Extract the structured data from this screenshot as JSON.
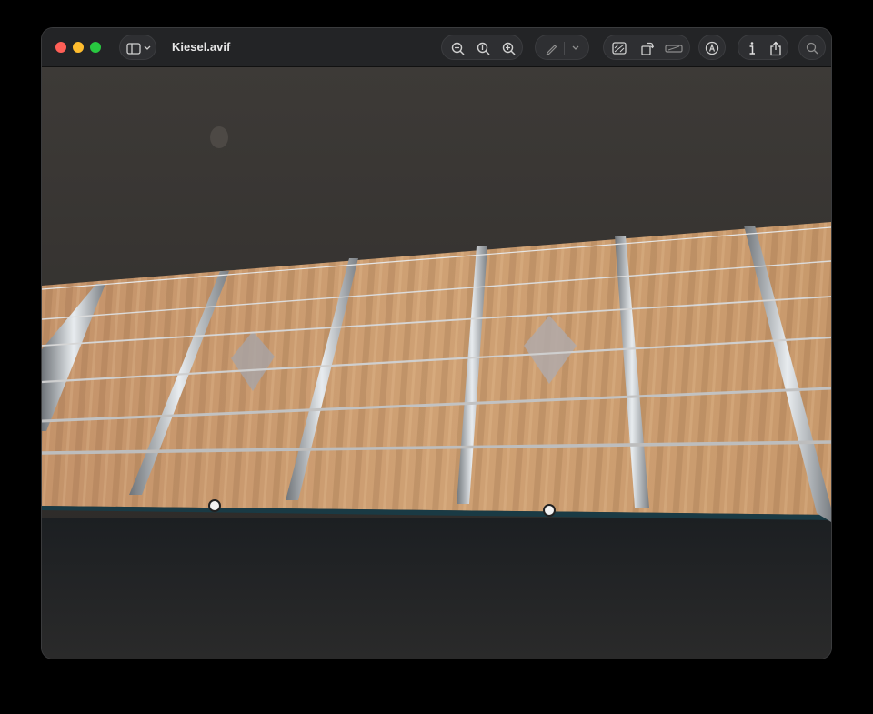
{
  "window": {
    "title": "Kiesel.avif"
  },
  "toolbar": {
    "icons": [
      "sidebar-toggle-icon",
      "chevron-down-icon",
      "zoom-out-icon",
      "actual-size-icon",
      "zoom-in-icon",
      "markup-pen-icon",
      "chevron-down-icon",
      "image-adjust-icon",
      "rotate-icon",
      "crop-icon",
      "markup-icon",
      "info-icon",
      "share-icon",
      "search-icon"
    ]
  },
  "colors": {
    "maple": "#c89a6a",
    "fret": "#cfd3d6",
    "background": "#2b2b2b"
  }
}
